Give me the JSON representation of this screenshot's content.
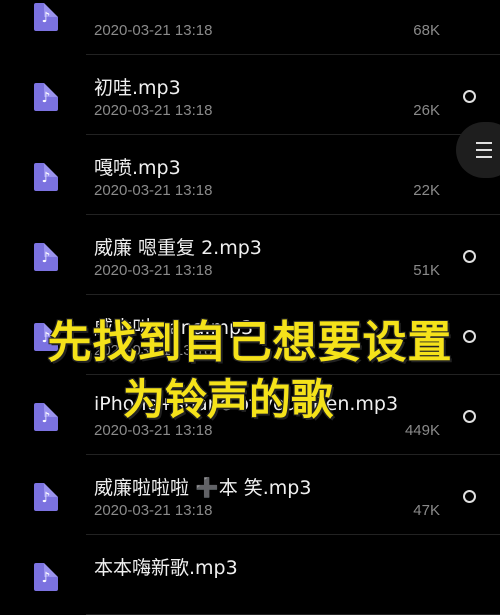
{
  "files": [
    {
      "name": "",
      "date": "2020-03-21 13:18",
      "size": "68K"
    },
    {
      "name": "初哇.mp3",
      "date": "2020-03-21 13:18",
      "size": "26K"
    },
    {
      "name": "嘎喷.mp3",
      "date": "2020-03-21 13:18",
      "size": "22K"
    },
    {
      "name": "威廉  嗯重复 2.mp3",
      "date": "2020-03-21 13:18",
      "size": "51K"
    },
    {
      "name": "威本叫 nana.mp3",
      "date": "2020-03-21 13:18",
      "size": "66K"
    },
    {
      "name": "iPhone+shape of you+Ben.mp3",
      "date": "2020-03-21 13:18",
      "size": "449K"
    },
    {
      "name": "威廉啦啦啦 ➕本 笑.mp3",
      "date": "2020-03-21 13:18",
      "size": "47K"
    },
    {
      "name": "本本嗨新歌.mp3",
      "date": "",
      "size": ""
    }
  ],
  "file_icon": "music-note",
  "fab_icon": "menu-lines",
  "overlay": {
    "line1": "先找到自己想要设置",
    "line2": "为铃声的歌"
  },
  "colors": {
    "background": "#000000",
    "file_icon": "#7b72e0",
    "overlay_text": "#f5e21a"
  }
}
